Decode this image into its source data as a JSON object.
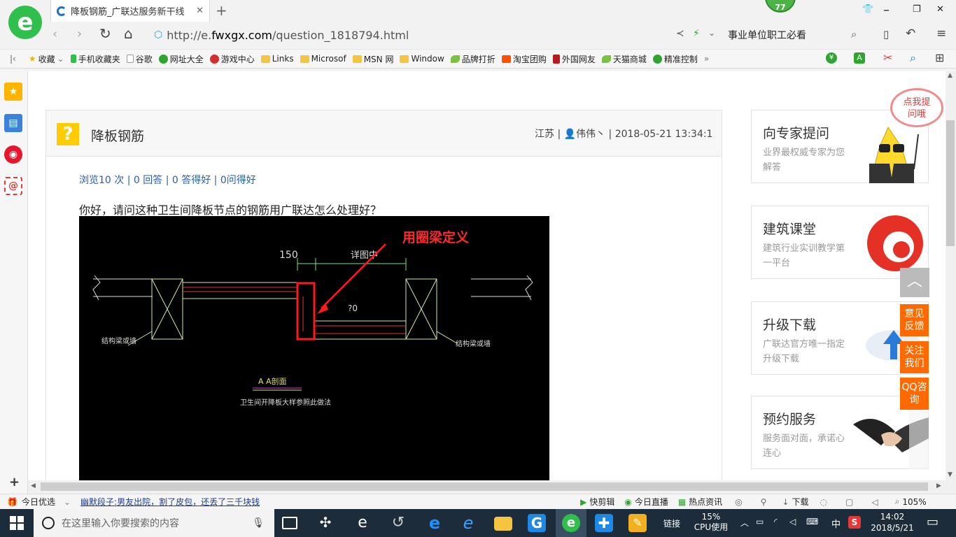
{
  "browser": {
    "tab_title": "降板钢筋_广联达服务新干线",
    "badge": "77",
    "url_prefix": "http://e.",
    "url_domain": "fwxgx.com",
    "url_path": "/question_1818794.html",
    "search_text": "事业单位职工必看",
    "bookmarks": [
      "收藏",
      "手机收藏夹",
      "谷歌",
      "网址大全",
      "游戏中心",
      "Links",
      "Microsof",
      "MSN 网",
      "Window",
      "品牌打折",
      "淘宝团购",
      "外国网友",
      "天猫商城",
      "精准控制"
    ]
  },
  "question": {
    "title": "降板钢筋",
    "province": "江苏",
    "user": "伟伟丶",
    "datetime": "2018-05-21 13:34:1",
    "stats": "浏览10 次 | 0 回答 | 0 答得好 | 0问得好",
    "text": "你好，请问这种卫生间降板节点的钢筋用广联达怎么处理好？"
  },
  "drawing": {
    "annotation": "用圈梁定义",
    "dim_left": "150",
    "dim_right": "详图中",
    "dim_depth": "?0",
    "label_left": "结构梁或墙",
    "label_right": "结构梁或墙",
    "section": "A A剖面",
    "caption": "卫生间开降板大样参照此做法"
  },
  "cards": [
    {
      "title": "向专家提问",
      "desc": "业界最权威专家为您解答",
      "bubble": "点我提问哦"
    },
    {
      "title": "建筑课堂",
      "desc": "建筑行业实训教学第一平台"
    },
    {
      "title": "升级下载",
      "desc": "广联达官方唯一指定升级下载"
    },
    {
      "title": "预约服务",
      "desc": "服务面对面，承诺心连心"
    }
  ],
  "side_buttons": [
    "意见反馈",
    "关注我们",
    "QQ咨询"
  ],
  "status": {
    "left": "今日优选",
    "news": "幽默段子:男友出院，割了皮包，还丢了三千块钱",
    "items": [
      "快剪辑",
      "今日直播",
      "热点资讯",
      "下载"
    ],
    "zoom": "105%"
  },
  "taskbar": {
    "search_placeholder": "在这里输入你要搜索的内容",
    "links": "链接",
    "cpu": "15%",
    "cpu_label": "CPU使用",
    "ime": "中",
    "time": "14:02",
    "date": "2018/5/21"
  },
  "colors": {
    "accent_orange": "#ff6a00",
    "question_yellow": "#ffcc00",
    "link_blue": "#2a5da8",
    "brand_green": "#2fc04c"
  }
}
